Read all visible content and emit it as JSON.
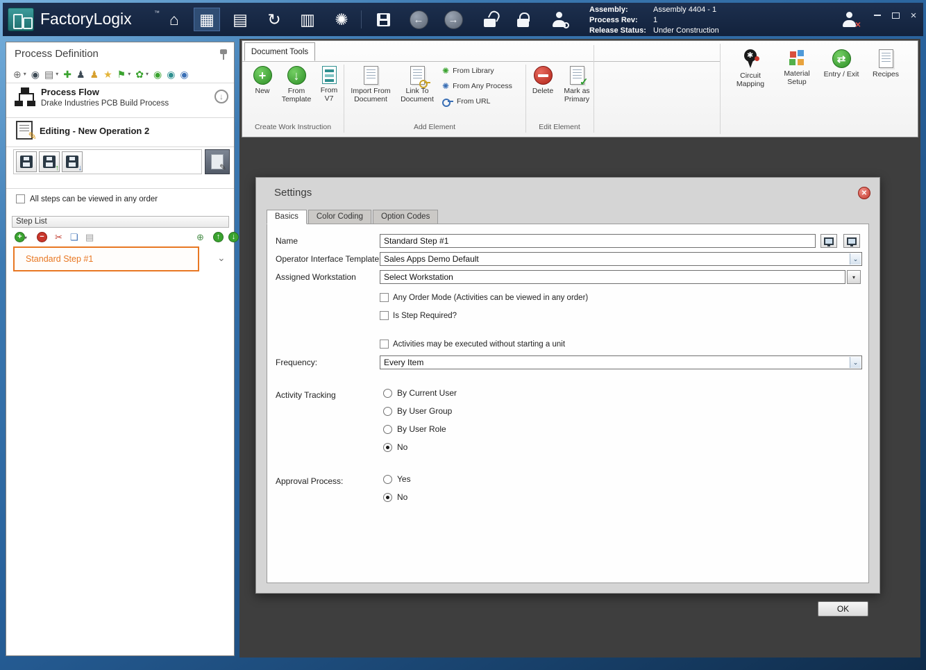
{
  "icons": {
    "home": "⌂",
    "grid": "▦",
    "documents": "▤",
    "sync": "↻",
    "news": "▥",
    "gear": "✺",
    "back": "←",
    "forward": "→",
    "down": "↓",
    "up": "↑",
    "chevron_down": "⌄",
    "caret_down": "▾",
    "plus": "+",
    "minus": "−",
    "close": "✕",
    "close_window": "×",
    "check": "✓",
    "scissors": "✂",
    "copy": "❏",
    "paste": "▤",
    "circle_plus": "⊕",
    "star": "★",
    "flag": "⚑",
    "plugin": "✚",
    "user_pawn": "♟",
    "flower": "✿",
    "dot_circle": "◉",
    "swap": "⇄",
    "pencil": "✎",
    "asterisk": "✱"
  },
  "titlebar": {
    "app_name": "FactoryLogix",
    "trademark": "™",
    "info_rows": [
      {
        "label": "Assembly:",
        "value": "Assembly 4404 - 1"
      },
      {
        "label": "Process Rev:",
        "value": "1"
      },
      {
        "label": "Release Status:",
        "value": "Under Construction"
      }
    ]
  },
  "left_panel": {
    "title": "Process Definition",
    "process_flow_title": "Process Flow",
    "process_flow_subtitle": "Drake Industries PCB Build Process",
    "editing_title": "Editing - New Operation 2",
    "order_checkbox_label": "All steps can be viewed in any order",
    "step_list_header": "Step List",
    "steps": [
      {
        "label": "Standard Step #1"
      }
    ]
  },
  "ribbon": {
    "tab_label": "Document Tools",
    "groups": [
      {
        "label": "Create Work Instruction",
        "items": [
          {
            "label": "New"
          },
          {
            "label": "From Template"
          },
          {
            "label": "From V7"
          }
        ]
      },
      {
        "label": "Add Element",
        "items": [
          {
            "label": "Import From Document"
          },
          {
            "label": "Link To Document"
          },
          {
            "label": "From Library"
          },
          {
            "label": "From Any Process"
          },
          {
            "label": "From URL"
          }
        ]
      },
      {
        "label": "Edit Element",
        "items": [
          {
            "label": "Delete"
          },
          {
            "label": "Mark as Primary"
          }
        ]
      }
    ],
    "right_items": [
      {
        "label": "Circuit Mapping"
      },
      {
        "label": "Material Setup"
      },
      {
        "label": "Entry / Exit"
      },
      {
        "label": "Recipes"
      }
    ]
  },
  "settings": {
    "title": "Settings",
    "tabs": [
      {
        "label": "Basics"
      },
      {
        "label": "Color Coding"
      },
      {
        "label": "Option Codes"
      }
    ],
    "name_label": "Name",
    "name_value": "Standard Step #1",
    "template_label": "Operator Interface Template",
    "template_value": "Sales Apps Demo Default",
    "workstation_label": "Assigned Workstation",
    "workstation_value": "Select Workstation",
    "any_order_label": "Any Order Mode (Activities can be viewed in any order)",
    "step_required_label": "Is Step Required?",
    "activities_label": "Activities may be executed without starting a unit",
    "frequency_label": "Frequency:",
    "frequency_value": "Every Item",
    "activity_tracking_label": "Activity Tracking",
    "activity_options": [
      {
        "label": "By Current User",
        "selected": false
      },
      {
        "label": "By User Group",
        "selected": false
      },
      {
        "label": "By User Role",
        "selected": false
      },
      {
        "label": "No",
        "selected": true
      }
    ],
    "approval_label": "Approval Process:",
    "approval_options": [
      {
        "label": "Yes",
        "selected": false
      },
      {
        "label": "No",
        "selected": true
      }
    ],
    "ok_label": "OK"
  }
}
